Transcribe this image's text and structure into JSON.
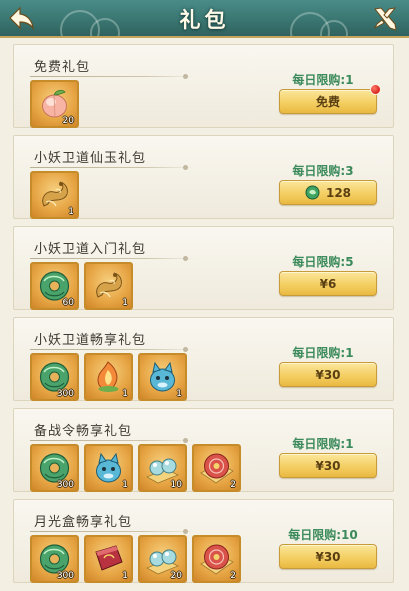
{
  "header": {
    "title": "礼包",
    "colors": {
      "bar": "#3a7672",
      "trim": "#c7a45c"
    }
  },
  "packs": [
    {
      "name": "免费礼包",
      "limit": "每日限购:1",
      "price": "免费",
      "currency_icon": "",
      "has_red_dot": true,
      "items": [
        {
          "icon": "peach-icon",
          "count": "20"
        }
      ]
    },
    {
      "name": "小妖卫道仙玉礼包",
      "limit": "每日限购:3",
      "price": "128",
      "currency_icon": "jade-currency-icon",
      "has_red_dot": false,
      "items": [
        {
          "icon": "dragon-icon",
          "count": "1"
        }
      ]
    },
    {
      "name": "小妖卫道入门礼包",
      "limit": "每日限购:5",
      "price": "¥6",
      "currency_icon": "",
      "has_red_dot": false,
      "items": [
        {
          "icon": "jade-dragon-icon",
          "count": "60"
        },
        {
          "icon": "dragon-icon",
          "count": "1"
        }
      ]
    },
    {
      "name": "小妖卫道畅享礼包",
      "limit": "每日限购:1",
      "price": "¥30",
      "currency_icon": "",
      "has_red_dot": false,
      "items": [
        {
          "icon": "jade-dragon-icon",
          "count": "300"
        },
        {
          "icon": "flame-bud-icon",
          "count": "1"
        },
        {
          "icon": "blue-creature-icon",
          "count": "1"
        }
      ]
    },
    {
      "name": "备战令畅享礼包",
      "limit": "每日限购:1",
      "price": "¥30",
      "currency_icon": "",
      "has_red_dot": false,
      "items": [
        {
          "icon": "jade-dragon-icon",
          "count": "300"
        },
        {
          "icon": "blue-creature-icon",
          "count": "1"
        },
        {
          "icon": "pearls-icon",
          "count": "10"
        },
        {
          "icon": "red-flower-icon",
          "count": "2"
        }
      ]
    },
    {
      "name": "月光盒畅享礼包",
      "limit": "每日限购:10",
      "price": "¥30",
      "currency_icon": "",
      "has_red_dot": false,
      "items": [
        {
          "icon": "jade-dragon-icon",
          "count": "300"
        },
        {
          "icon": "moon-box-icon",
          "count": "1"
        },
        {
          "icon": "pearls-icon",
          "count": "20"
        },
        {
          "icon": "red-flower-icon",
          "count": "2"
        }
      ]
    }
  ]
}
